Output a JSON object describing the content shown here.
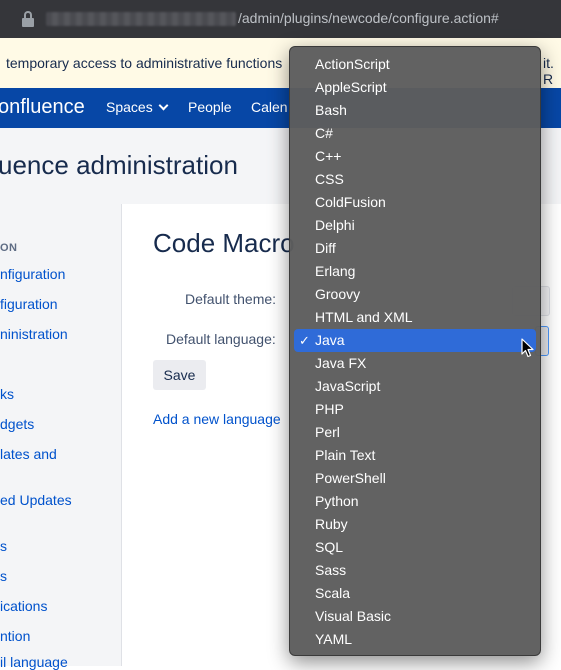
{
  "browser": {
    "url_visible": "/admin/plugins/newcode/configure.action#"
  },
  "banner": {
    "text": "temporary access to administrative functions",
    "tail": "it. R"
  },
  "nav": {
    "logo": "onfluence",
    "items": [
      "Spaces",
      "People",
      "Calen"
    ]
  },
  "admin": {
    "title": "uence administration"
  },
  "sidebar": {
    "section": "ON",
    "links": [
      "nfiguration",
      "figuration",
      "ninistration",
      "ks",
      "dgets",
      "lates and",
      "ed Updates",
      "s",
      "s",
      "ications",
      "ntion",
      "il language"
    ]
  },
  "main": {
    "title": "Code Macro",
    "default_theme_label": "Default theme:",
    "default_language_label": "Default language:",
    "save_label": "Save",
    "add_language_link": "Add a new language"
  },
  "dropdown": {
    "selected": "Java",
    "check_glyph": "✓",
    "options": [
      "ActionScript",
      "AppleScript",
      "Bash",
      "C#",
      "C++",
      "CSS",
      "ColdFusion",
      "Delphi",
      "Diff",
      "Erlang",
      "Groovy",
      "HTML and XML",
      "Java",
      "Java FX",
      "JavaScript",
      "PHP",
      "Perl",
      "Plain Text",
      "PowerShell",
      "Python",
      "Ruby",
      "SQL",
      "Sass",
      "Scala",
      "Visual Basic",
      "YAML"
    ]
  },
  "icons": {
    "lock": "lock-icon",
    "chevron": "chevron-down-icon",
    "cursor": "mouse-pointer-icon",
    "check": "checkmark-icon"
  },
  "colors": {
    "nav_bg": "#0747a6",
    "banner_bg": "#fffae6",
    "selection": "#2f6bd8",
    "link": "#0052cc"
  }
}
